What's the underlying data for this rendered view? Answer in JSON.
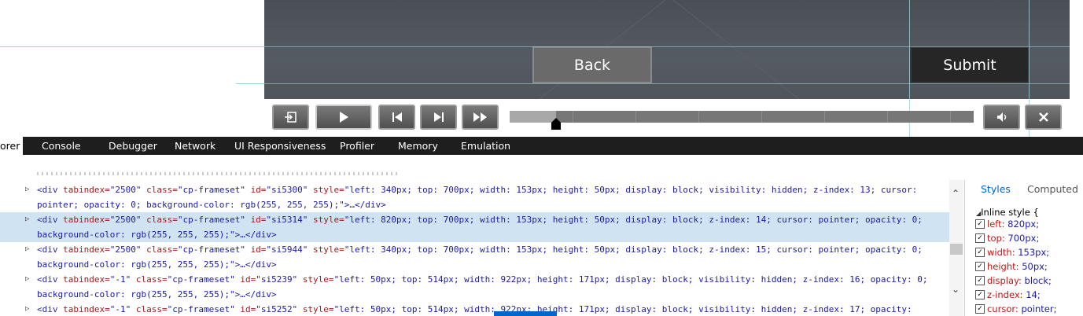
{
  "stage": {
    "back_label": "Back",
    "submit_label": "Submit"
  },
  "playbar": {
    "exit_icon": "exit-icon",
    "play_icon": "play-icon",
    "rewind_icon": "skip-back-icon",
    "forward_icon": "skip-forward-icon",
    "fast_forward_icon": "fast-forward-icon",
    "audio_icon": "speaker-icon",
    "close_icon": "close-icon",
    "progress": 0.1
  },
  "devtools": {
    "tabs": [
      {
        "label": "orer"
      },
      {
        "label": "Console"
      },
      {
        "label": "Debugger"
      },
      {
        "label": "Network"
      },
      {
        "label": "UI Responsiveness"
      },
      {
        "label": "Profiler"
      },
      {
        "label": "Memory"
      },
      {
        "label": "Emulation"
      }
    ],
    "dom_lines": [
      {
        "a": "<div ",
        "b": "tabindex=",
        "c": "\"2500\" ",
        "d": "class=",
        "e": "\"cp-frameset\" ",
        "f": "id=",
        "g": "\"si5300\" ",
        "h": "style=",
        "i": "\"left: 340px; top: 700px; width: 153px; height: 50px; display: block; visibility: hidden; z-index: 13; cursor:",
        "cont": "pointer; opacity: 0; background-color: rgb(255, 255, 255);\">…</div>"
      },
      {
        "a": "<div ",
        "b": "tabindex=",
        "c": "\"2500\" ",
        "d": "class=",
        "e": "\"cp-frameset\" ",
        "f": "id=",
        "g": "\"si5314\" ",
        "h": "style=",
        "i": "\"left: 820px; top: 700px; width: 153px; height: 50px; display: block; z-index: 14; cursor: pointer; opacity: 0;",
        "cont": "background-color: rgb(255, 255, 255);\">…</div>"
      },
      {
        "a": "<div ",
        "b": "tabindex=",
        "c": "\"2500\" ",
        "d": "class=",
        "e": "\"cp-frameset\" ",
        "f": "id=",
        "g": "\"si5944\" ",
        "h": "style=",
        "i": "\"left: 340px; top: 700px; width: 153px; height: 50px; display: block; z-index: 15; cursor: pointer; opacity: 0;",
        "cont": "background-color: rgb(255, 255, 255);\">…</div>"
      },
      {
        "a": "<div ",
        "b": "tabindex=",
        "c": "\"-1\" ",
        "d": "class=",
        "e": "\"cp-frameset\" ",
        "f": "id=",
        "g": "\"si5239\" ",
        "h": "style=",
        "i": "\"left: 50px; top: 514px; width: 922px; height: 171px; display: block; visibility: hidden; z-index: 16; opacity: 0;",
        "cont": "background-color: rgb(255, 255, 255);\">…</div>"
      },
      {
        "a": "<div ",
        "b": "tabindex=",
        "c": "\"-1\" ",
        "d": "class=",
        "e": "\"cp-frameset\" ",
        "f": "id=",
        "g": "\"si5252\" ",
        "h": "style=",
        "i": "\"left: 50px; top: 514px; width: 922px; height: 171px; display: block; visibility: hidden; z-index: 17; opacity:",
        "cont": ""
      }
    ],
    "styles": {
      "tab_styles": "Styles",
      "tab_computed": "Computed",
      "rule_header": "Inline style  {",
      "props": [
        {
          "name": "left",
          "value": "820px;"
        },
        {
          "name": "top",
          "value": "700px;"
        },
        {
          "name": "width",
          "value": "153px;"
        },
        {
          "name": "height",
          "value": "50px;"
        },
        {
          "name": "display",
          "value": "block;"
        },
        {
          "name": "z-index",
          "value": "14;"
        },
        {
          "name": "cursor",
          "value": "pointer;"
        }
      ]
    },
    "colors": {
      "accent": "#0066cc",
      "highlight": "#cfe3f2",
      "tabbar": "#1e1e1e"
    }
  }
}
